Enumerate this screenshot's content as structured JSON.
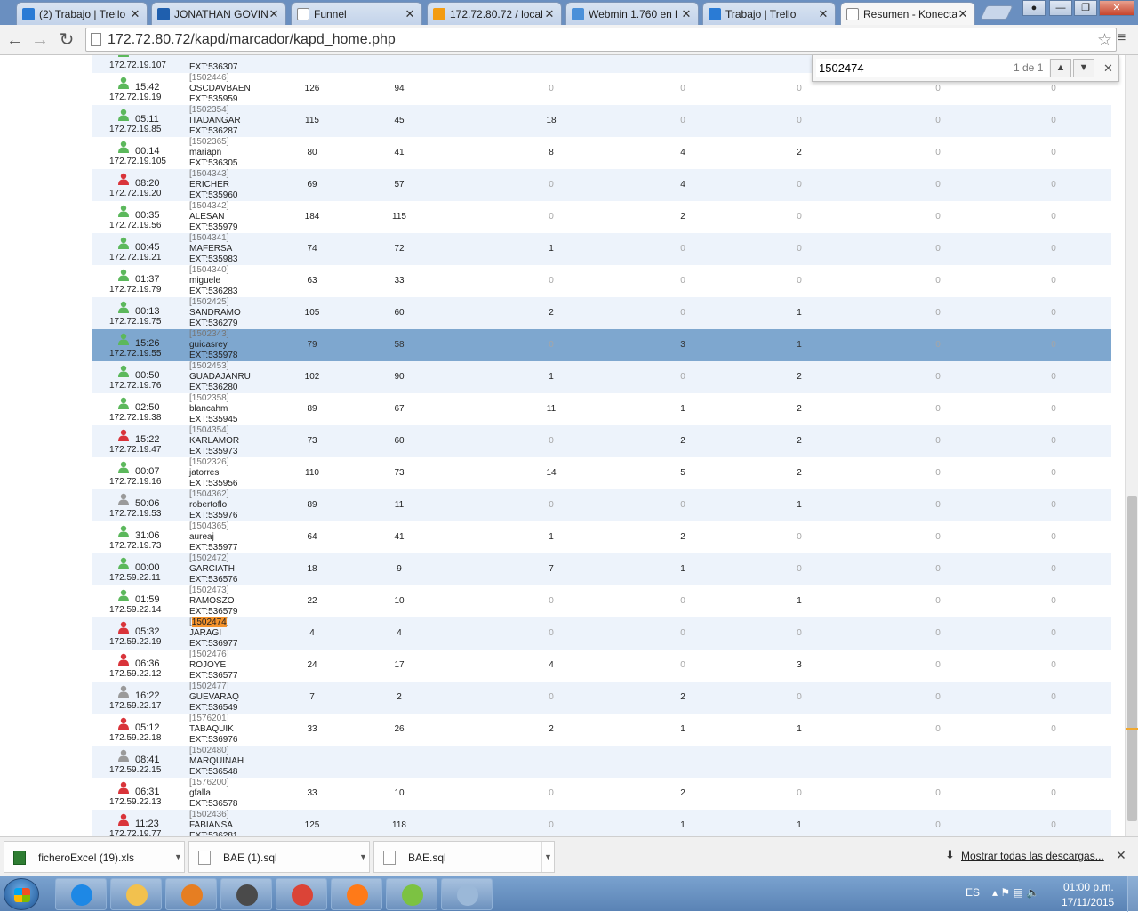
{
  "tabs": [
    {
      "title": "(2) Trabajo | Trello",
      "icon": "trello-icon",
      "left": 0
    },
    {
      "title": "JONATHAN GOVIN",
      "icon": "outlook-icon",
      "left": 0
    },
    {
      "title": "Funnel",
      "icon": "page-icon",
      "left": 0
    },
    {
      "title": "172.72.80.72 / local",
      "icon": "phpmyadmin-icon",
      "left": 0
    },
    {
      "title": "Webmin 1.760 en l",
      "icon": "webmin-icon",
      "left": 0
    },
    {
      "title": "Trabajo | Trello",
      "icon": "trello-icon",
      "left": 0
    },
    {
      "title": "Resumen - Konecta",
      "icon": "page-icon",
      "left": 0
    }
  ],
  "address": {
    "url": "172.72.80.72/kapd/marcador/kapd_home.php"
  },
  "find": {
    "query": "1502474",
    "count": "1 de 1"
  },
  "rows": [
    {
      "time": "",
      "ip": "172.72.19.107",
      "id": "",
      "name": "",
      "ext": "EXT:536307",
      "status": "green",
      "vals": [
        "",
        "",
        "",
        "",
        "",
        "",
        ""
      ]
    },
    {
      "time": "15:42",
      "ip": "172.72.19.19",
      "id": "[1502446]",
      "name": "OSCDAVBAEN",
      "ext": "EXT:535959",
      "status": "green",
      "vals": [
        "126",
        "94",
        "0",
        "0",
        "0",
        "0",
        "0"
      ]
    },
    {
      "time": "05:11",
      "ip": "172.72.19.85",
      "id": "[1502354]",
      "name": "ITADANGAR",
      "ext": "EXT:536287",
      "status": "green",
      "vals": [
        "115",
        "45",
        "18",
        "0",
        "0",
        "0",
        "0"
      ]
    },
    {
      "time": "00:14",
      "ip": "172.72.19.105",
      "id": "[1502365]",
      "name": "mariapn",
      "ext": "EXT:536305",
      "status": "green",
      "vals": [
        "80",
        "41",
        "8",
        "4",
        "2",
        "0",
        "0"
      ]
    },
    {
      "time": "08:20",
      "ip": "172.72.19.20",
      "id": "[1504343]",
      "name": "ERICHER",
      "ext": "EXT:535960",
      "status": "red",
      "vals": [
        "69",
        "57",
        "0",
        "4",
        "0",
        "0",
        "0"
      ]
    },
    {
      "time": "00:35",
      "ip": "172.72.19.56",
      "id": "[1504342]",
      "name": "ALESAN",
      "ext": "EXT:535979",
      "status": "green",
      "vals": [
        "184",
        "115",
        "0",
        "2",
        "0",
        "0",
        "0"
      ]
    },
    {
      "time": "00:45",
      "ip": "172.72.19.21",
      "id": "[1504341]",
      "name": "MAFERSA",
      "ext": "EXT:535983",
      "status": "green",
      "vals": [
        "74",
        "72",
        "1",
        "0",
        "0",
        "0",
        "0"
      ]
    },
    {
      "time": "01:37",
      "ip": "172.72.19.79",
      "id": "[1504340]",
      "name": "miguele",
      "ext": "EXT:536283",
      "status": "green",
      "vals": [
        "63",
        "33",
        "0",
        "0",
        "0",
        "0",
        "0"
      ]
    },
    {
      "time": "00:13",
      "ip": "172.72.19.75",
      "id": "[1502425]",
      "name": "SANDRAMO",
      "ext": "EXT:536279",
      "status": "green",
      "vals": [
        "105",
        "60",
        "2",
        "0",
        "1",
        "0",
        "0"
      ]
    },
    {
      "time": "15:26",
      "ip": "172.72.19.55",
      "id": "[1502343]",
      "name": "guicasrey",
      "ext": "EXT:535978",
      "status": "green",
      "selected": true,
      "vals": [
        "79",
        "58",
        "0",
        "3",
        "1",
        "0",
        "0"
      ]
    },
    {
      "time": "00:50",
      "ip": "172.72.19.76",
      "id": "[1502453]",
      "name": "GUADAJANRU",
      "ext": "EXT:536280",
      "status": "green",
      "vals": [
        "102",
        "90",
        "1",
        "0",
        "2",
        "0",
        "0"
      ]
    },
    {
      "time": "02:50",
      "ip": "172.72.19.38",
      "id": "[1502358]",
      "name": "blancahm",
      "ext": "EXT:535945",
      "status": "green",
      "vals": [
        "89",
        "67",
        "11",
        "1",
        "2",
        "0",
        "0"
      ]
    },
    {
      "time": "15:22",
      "ip": "172.72.19.47",
      "id": "[1504354]",
      "name": "KARLAMOR",
      "ext": "EXT:535973",
      "status": "red",
      "vals": [
        "73",
        "60",
        "0",
        "2",
        "2",
        "0",
        "0"
      ]
    },
    {
      "time": "00:07",
      "ip": "172.72.19.16",
      "id": "[1502326]",
      "name": "jatorres",
      "ext": "EXT:535956",
      "status": "green",
      "vals": [
        "110",
        "73",
        "14",
        "5",
        "2",
        "0",
        "0"
      ]
    },
    {
      "time": "50:06",
      "ip": "172.72.19.53",
      "id": "[1504362]",
      "name": "robertoflo",
      "ext": "EXT:535976",
      "status": "gray",
      "vals": [
        "89",
        "11",
        "0",
        "0",
        "1",
        "0",
        "0"
      ]
    },
    {
      "time": "31:06",
      "ip": "172.72.19.73",
      "id": "[1504365]",
      "name": "aureaj",
      "ext": "EXT:535977",
      "status": "green",
      "vals": [
        "64",
        "41",
        "1",
        "2",
        "0",
        "0",
        "0"
      ]
    },
    {
      "time": "00:00",
      "ip": "172.59.22.11",
      "id": "[1502472]",
      "name": "GARCIATH",
      "ext": "EXT:536576",
      "status": "green",
      "vals": [
        "18",
        "9",
        "7",
        "1",
        "0",
        "0",
        "0"
      ]
    },
    {
      "time": "01:59",
      "ip": "172.59.22.14",
      "id": "[1502473]",
      "name": "RAMOSZO",
      "ext": "EXT:536579",
      "status": "green",
      "vals": [
        "22",
        "10",
        "0",
        "0",
        "1",
        "0",
        "0"
      ]
    },
    {
      "time": "05:32",
      "ip": "172.59.22.19",
      "id": "[1502474]",
      "name": "JARAGI",
      "ext": "EXT:536977",
      "status": "red",
      "highlight": true,
      "vals": [
        "4",
        "4",
        "0",
        "0",
        "0",
        "0",
        "0"
      ]
    },
    {
      "time": "06:36",
      "ip": "172.59.22.12",
      "id": "[1502476]",
      "name": "ROJOYE",
      "ext": "EXT:536577",
      "status": "red",
      "vals": [
        "24",
        "17",
        "4",
        "0",
        "3",
        "0",
        "0"
      ]
    },
    {
      "time": "16:22",
      "ip": "172.59.22.17",
      "id": "[1502477]",
      "name": "GUEVARAQ",
      "ext": "EXT:536549",
      "status": "gray",
      "vals": [
        "7",
        "2",
        "0",
        "2",
        "0",
        "0",
        "0"
      ]
    },
    {
      "time": "05:12",
      "ip": "172.59.22.18",
      "id": "[1576201]",
      "name": "TABAQUIK",
      "ext": "EXT:536976",
      "status": "red",
      "vals": [
        "33",
        "26",
        "2",
        "1",
        "1",
        "0",
        "0"
      ]
    },
    {
      "time": "08:41",
      "ip": "172.59.22.15",
      "id": "[1502480]",
      "name": "MARQUINAH",
      "ext": "EXT:536548",
      "status": "gray",
      "vals": [
        "",
        "",
        "",
        "",
        "",
        "",
        ""
      ]
    },
    {
      "time": "06:31",
      "ip": "172.59.22.13",
      "id": "[1576200]",
      "name": "gfalla",
      "ext": "EXT:536578",
      "status": "red",
      "vals": [
        "33",
        "10",
        "0",
        "2",
        "0",
        "0",
        "0"
      ]
    },
    {
      "time": "11:23",
      "ip": "172.72.19.77",
      "id": "[1502436]",
      "name": "FABIANSA",
      "ext": "EXT:536281",
      "status": "red",
      "vals": [
        "125",
        "118",
        "0",
        "1",
        "1",
        "0",
        "0"
      ]
    }
  ],
  "downloads": [
    {
      "name": "ficheroExcel (19).xls",
      "type": "xls"
    },
    {
      "name": "BAE (1).sql",
      "type": "file"
    },
    {
      "name": "BAE.sql",
      "type": "file"
    }
  ],
  "downloads_show_all": "Mostrar todas las descargas...",
  "taskbar": {
    "apps": [
      "ie-icon",
      "explorer-icon",
      "media-player-icon",
      "sublime-icon",
      "chrome-icon",
      "firefox-icon",
      "gecko-icon",
      "paint-icon"
    ],
    "lang": "ES",
    "time": "01:00 p.m.",
    "date": "17/11/2015"
  },
  "colors": {
    "row_alt": "#edf3fb",
    "row_selected": "#7ea7cf",
    "find_highlight": "#f4922b",
    "status_green": "#5cb85c",
    "status_red": "#d9343a",
    "status_gray": "#9a9a9a"
  }
}
